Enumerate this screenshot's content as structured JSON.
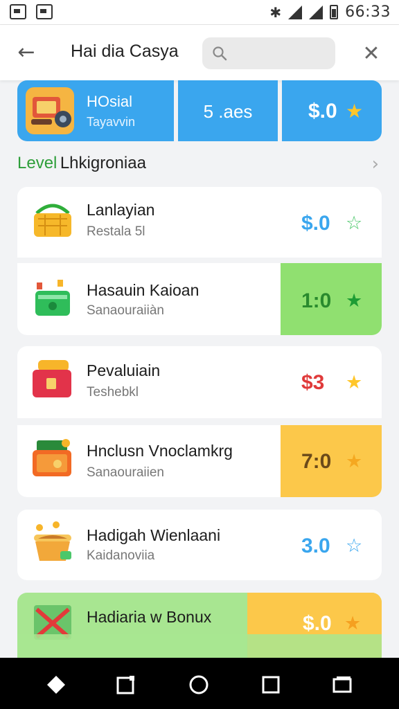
{
  "status_bar": {
    "time": "66:33",
    "icons": [
      "notification-box-icon",
      "notification-image-icon",
      "bluetooth-icon",
      "signal-icon",
      "wifi-icon",
      "battery-icon"
    ]
  },
  "app_bar": {
    "title": "Hai dia  Casya",
    "search_value": "",
    "search_placeholder": "",
    "icons": [
      "back-arrow-icon",
      "search-icon",
      "close-icon"
    ]
  },
  "summary": {
    "title": "HOsial",
    "subtitle": "Tayavvin",
    "middle_value": "5 .aes",
    "right_value": "$.0",
    "right_icon": "star-icon"
  },
  "section": {
    "label_green": "Level",
    "label_dark": "Lhkigroniaa",
    "chevron": "chevron-right-icon"
  },
  "items": [
    {
      "name": "Lanlayian",
      "sub": "Restala 5l",
      "price": "$.0",
      "price_color": "#3aa6ee",
      "star": "☆",
      "star_color": "#4cc76a",
      "panel_color": "#ffffff",
      "icon": "gold-basket-icon"
    },
    {
      "name": "Hasauin Kaioan",
      "sub": "Sanaouraiiàn",
      "price": "1:0",
      "price_color": "#2a8a2e",
      "star": "★",
      "star_color": "#1e9c34",
      "panel_color": "#90e070",
      "icon": "green-bucket-icon"
    },
    {
      "name": "Pevaluiain",
      "sub": "Teshebkl",
      "price": "$3",
      "price_color": "#e03a3a",
      "star": "★",
      "star_color": "#ffc62a",
      "panel_color": "#ffffff",
      "icon": "red-chest-icon"
    },
    {
      "name": "Hnclusn Vnoclamkrg",
      "sub": "Sanaouraiien",
      "price": "7:0",
      "price_color": "#6b4a1a",
      "star": "★",
      "star_color": "#f5a820",
      "panel_color": "#fcc84a",
      "icon": "cash-box-icon"
    },
    {
      "name": "Hadigah Wienlaani",
      "sub": "Kaidanoviia",
      "price": "3.0",
      "price_color": "#3aa6ee",
      "star": "☆",
      "star_color": "#3aa6ee",
      "panel_color": "#ffffff",
      "icon": "coin-bowl-icon"
    },
    {
      "name": "Hadiaria  w Bonux",
      "sub": "",
      "price": "$.0",
      "price_color": "#ffffff",
      "star": "★",
      "star_color": "#f5a020",
      "panel_color": "#fcc84a",
      "icon": "map-icon"
    }
  ],
  "nav_bar": {
    "icons": [
      "diamond-icon",
      "recents-icon",
      "home-circle-icon",
      "square-icon",
      "window-icon"
    ]
  }
}
